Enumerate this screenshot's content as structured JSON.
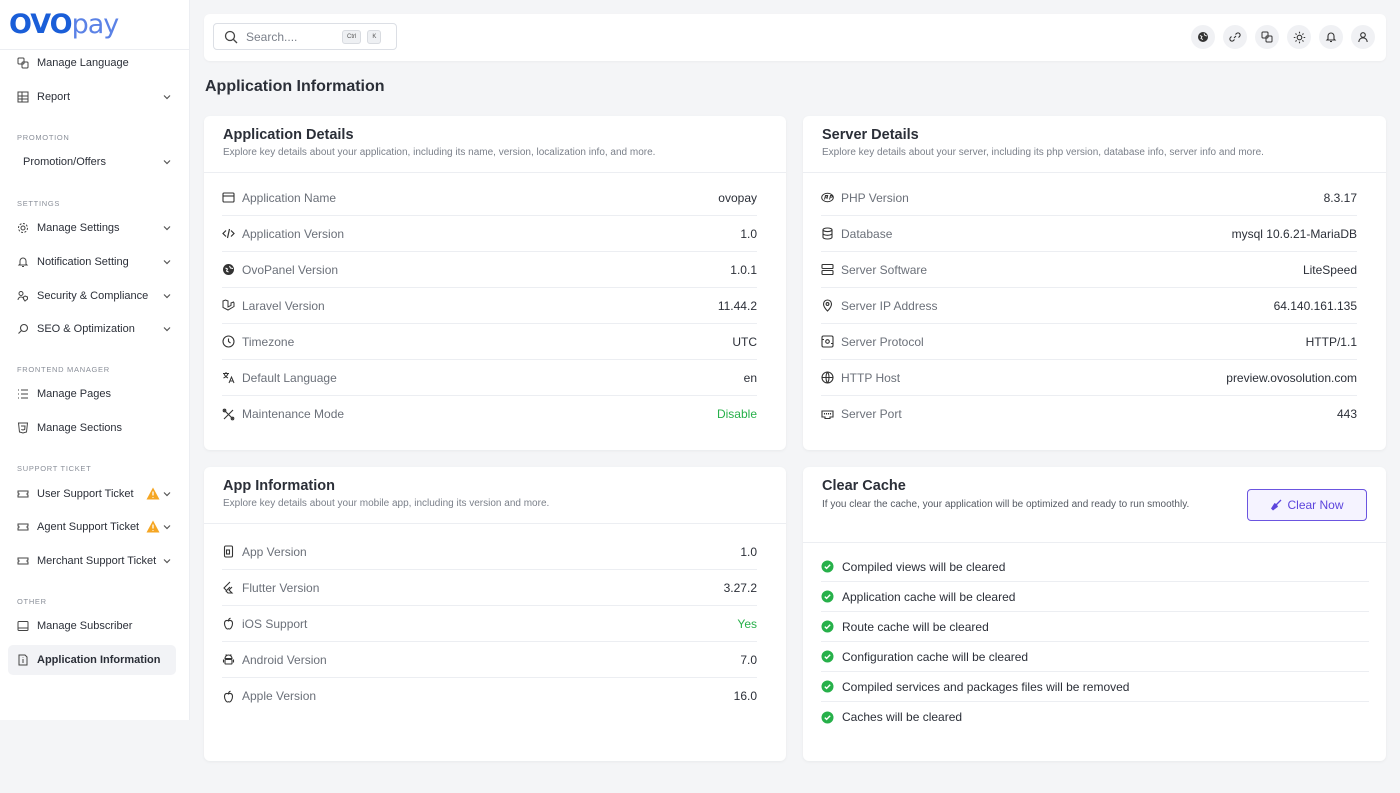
{
  "brand": {
    "logo_main": "OVO",
    "logo_sub": "pay"
  },
  "sidebar": {
    "items": [
      {
        "label": "Manage Language"
      },
      {
        "label": "Report"
      },
      {
        "label": "Promotion/Offers"
      },
      {
        "label": "Manage Settings"
      },
      {
        "label": "Notification Setting"
      },
      {
        "label": "Security & Compliance"
      },
      {
        "label": "SEO & Optimization"
      },
      {
        "label": "Manage Pages"
      },
      {
        "label": "Manage Sections"
      },
      {
        "label": "User Support Ticket"
      },
      {
        "label": "Agent Support Ticket"
      },
      {
        "label": "Merchant Support Ticket"
      },
      {
        "label": "Manage Subscriber"
      },
      {
        "label": "Application Information"
      }
    ],
    "sections": {
      "promotion": "PROMOTION",
      "settings": "SETTINGS",
      "frontend": "FRONTEND MANAGER",
      "support": "SUPPORT TICKET",
      "other": "OTHER"
    }
  },
  "topbar": {
    "search_placeholder": "Search....",
    "kbd_ctrl": "Ctrl",
    "kbd_k": "K"
  },
  "page": {
    "title": "Application Information"
  },
  "app_details": {
    "title": "Application Details",
    "subtitle": "Explore key details about your application, including its name, version, localization info, and more.",
    "rows": [
      {
        "label": "Application Name",
        "value": "ovopay"
      },
      {
        "label": "Application Version",
        "value": "1.0"
      },
      {
        "label": "OvoPanel Version",
        "value": "1.0.1"
      },
      {
        "label": "Laravel Version",
        "value": "11.44.2"
      },
      {
        "label": "Timezone",
        "value": "UTC"
      },
      {
        "label": "Default Language",
        "value": "en"
      },
      {
        "label": "Maintenance Mode",
        "value": "Disable"
      }
    ]
  },
  "server_details": {
    "title": "Server Details",
    "subtitle": "Explore key details about your server, including its php version, database info, server info and more.",
    "rows": [
      {
        "label": "PHP Version",
        "value": "8.3.17"
      },
      {
        "label": "Database",
        "value": "mysql 10.6.21-MariaDB"
      },
      {
        "label": "Server Software",
        "value": "LiteSpeed"
      },
      {
        "label": "Server IP Address",
        "value": "64.140.161.135"
      },
      {
        "label": "Server Protocol",
        "value": "HTTP/1.1"
      },
      {
        "label": "HTTP Host",
        "value": "preview.ovosolution.com"
      },
      {
        "label": "Server Port",
        "value": "443"
      }
    ]
  },
  "app_info": {
    "title": "App Information",
    "subtitle": "Explore key details about your mobile app, including its version and more.",
    "rows": [
      {
        "label": "App Version",
        "value": "1.0"
      },
      {
        "label": "Flutter Version",
        "value": "3.27.2"
      },
      {
        "label": "iOS Support",
        "value": "Yes"
      },
      {
        "label": "Android Version",
        "value": "7.0"
      },
      {
        "label": "Apple Version",
        "value": "16.0"
      }
    ]
  },
  "clear_cache": {
    "title": "Clear Cache",
    "subtitle": "If you clear the cache, your application will be optimized and ready to run smoothly.",
    "button": "Clear Now",
    "items": [
      "Compiled views will be cleared",
      "Application cache will be cleared",
      "Route cache will be cleared",
      "Configuration cache will be cleared",
      "Compiled services and packages files will be removed",
      "Caches will be cleared"
    ]
  },
  "colors": {
    "accent": "#1a5ed8",
    "success": "#27b04a",
    "warning": "#f5a623",
    "button": "#5d45dd"
  }
}
